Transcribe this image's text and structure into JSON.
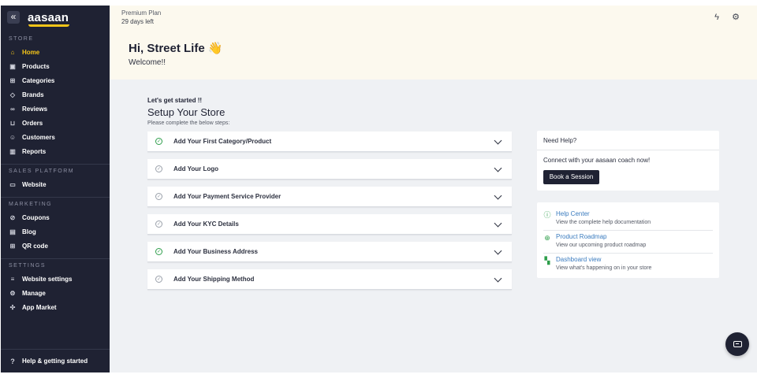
{
  "sidebar": {
    "collapse_icon": "«",
    "logo_text": "aasaan",
    "sections": {
      "store": "STORE",
      "sales_platform": "SALES PLATFORM",
      "marketing": "MARKETING",
      "settings": "SETTINGS"
    },
    "store_items": [
      {
        "label": "Home",
        "icon": "home-icon",
        "glyph": "⌂"
      },
      {
        "label": "Products",
        "icon": "box-icon",
        "glyph": "▣"
      },
      {
        "label": "Categories",
        "icon": "grid-icon",
        "glyph": "⊞"
      },
      {
        "label": "Brands",
        "icon": "tag-icon",
        "glyph": "◇"
      },
      {
        "label": "Reviews",
        "icon": "link-icon",
        "glyph": "∞"
      },
      {
        "label": "Orders",
        "icon": "cart-icon",
        "glyph": "⊔"
      },
      {
        "label": "Customers",
        "icon": "users-icon",
        "glyph": "☺"
      },
      {
        "label": "Reports",
        "icon": "bar-chart-icon",
        "glyph": "▥"
      }
    ],
    "sales_items": [
      {
        "label": "Website",
        "icon": "monitor-icon",
        "glyph": "▭"
      }
    ],
    "marketing_items": [
      {
        "label": "Coupons",
        "icon": "coupon-icon",
        "glyph": "⊘"
      },
      {
        "label": "Blog",
        "icon": "document-icon",
        "glyph": "▤"
      },
      {
        "label": "QR code",
        "icon": "qr-icon",
        "glyph": "⊞"
      }
    ],
    "settings_items": [
      {
        "label": "Website settings",
        "icon": "sliders-icon",
        "glyph": "≡"
      },
      {
        "label": "Manage",
        "icon": "gear-icon",
        "glyph": "⚙"
      },
      {
        "label": "App Market",
        "icon": "apps-icon",
        "glyph": "✣"
      }
    ],
    "footer_label": "Help & getting started",
    "footer_glyph": "?"
  },
  "header": {
    "plan_name": "Premium Plan",
    "plan_days": "29 days left",
    "bolt_glyph": "ϟ",
    "settings_glyph": "⚙"
  },
  "hero": {
    "greeting": "Hi, Street Life 👋",
    "welcome": "Welcome!!"
  },
  "setup": {
    "kicker": "Let's get started !!",
    "title": "Setup Your Store",
    "subtitle": "Please complete the below steps:",
    "check_glyph": "✓",
    "steps": [
      {
        "label": "Add Your First Category/Product",
        "done": true
      },
      {
        "label": "Add Your Logo",
        "done": false
      },
      {
        "label": "Add Your Payment Service Provider",
        "done": false
      },
      {
        "label": "Add Your KYC Details",
        "done": false
      },
      {
        "label": "Add Your Business Address",
        "done": true
      },
      {
        "label": "Add Your Shipping Method",
        "done": false
      }
    ]
  },
  "help": {
    "title": "Need Help?",
    "text": "Connect with your aasaan coach now!",
    "button": "Book a Session"
  },
  "links": [
    {
      "title": "Help Center",
      "desc": "View the complete help documentation",
      "icon": "info-icon",
      "glyph": "ⓘ"
    },
    {
      "title": "Product Roadmap",
      "desc": "View our upcoming product roadmap",
      "icon": "plus-circle-icon",
      "glyph": "⊕"
    },
    {
      "title": "Dashboard view",
      "desc": "View what's happening on in your store",
      "icon": "dashboard-icon",
      "glyph": "▚"
    }
  ],
  "colors": {
    "sidebar_bg": "#1f2233",
    "accent_yellow": "#f5c518",
    "hero_bg": "#fcf9ee",
    "main_bg": "#eff1f4",
    "done_green": "#2e9e4b",
    "link_blue": "#3a7bbf"
  }
}
